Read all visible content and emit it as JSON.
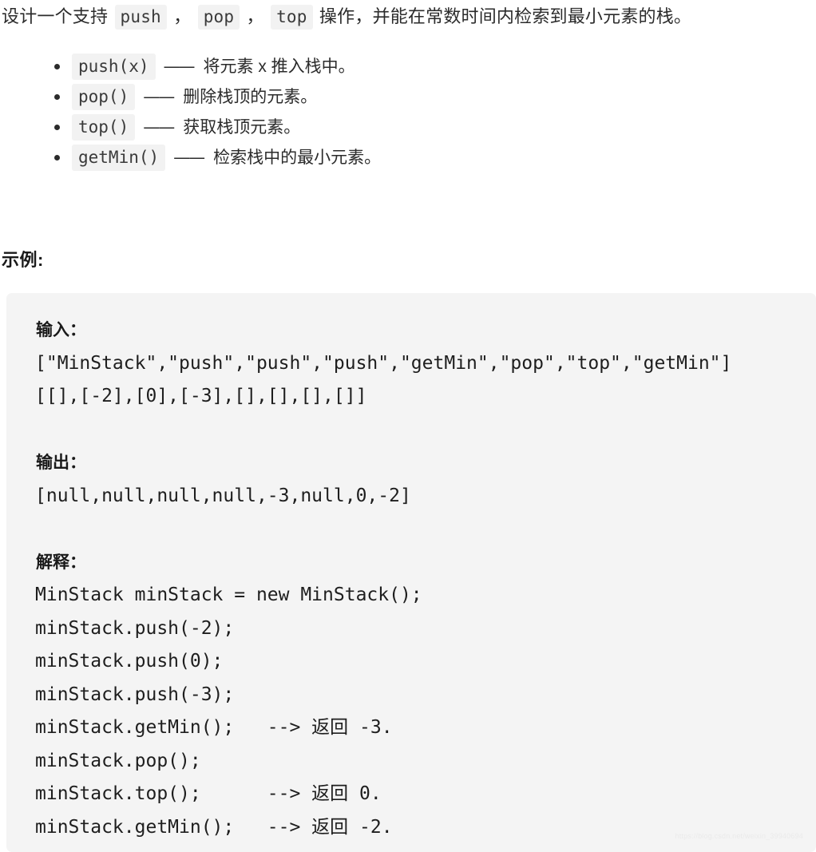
{
  "document": {
    "intro": {
      "prefix": "设计一个支持 ",
      "code_1": "push",
      "sep_1": " ， ",
      "code_2": "pop",
      "sep_2": " ， ",
      "code_3": "top",
      "suffix": " 操作，并能在常数时间内检索到最小元素的栈。"
    },
    "bullets": [
      {
        "code": "push(x)",
        "dash": "——",
        "desc": "将元素 x 推入栈中。"
      },
      {
        "code": "pop()",
        "dash": "——",
        "desc": "删除栈顶的元素。"
      },
      {
        "code": "top()",
        "dash": "——",
        "desc": "获取栈顶元素。"
      },
      {
        "code": "getMin()",
        "dash": "——",
        "desc": "检索栈中的最小元素。"
      }
    ],
    "example_heading": "示例:",
    "code_block": {
      "input_label": "输入：",
      "input_lines": [
        "[\"MinStack\",\"push\",\"push\",\"push\",\"getMin\",\"pop\",\"top\",\"getMin\"]",
        "[[],[-2],[0],[-3],[],[],[],[]]"
      ],
      "output_label": "输出：",
      "output_lines": [
        "[null,null,null,null,-3,null,0,-2]"
      ],
      "explain_label": "解释：",
      "explain_lines": [
        "MinStack minStack = new MinStack();",
        "minStack.push(-2);",
        "minStack.push(0);",
        "minStack.push(-3);",
        "minStack.getMin();   --> 返回 -3.",
        "minStack.pop();",
        "minStack.top();      --> 返回 0.",
        "minStack.getMin();   --> 返回 -2."
      ]
    },
    "watermark": "https://blog.csdn.net/weixin_39940694"
  }
}
